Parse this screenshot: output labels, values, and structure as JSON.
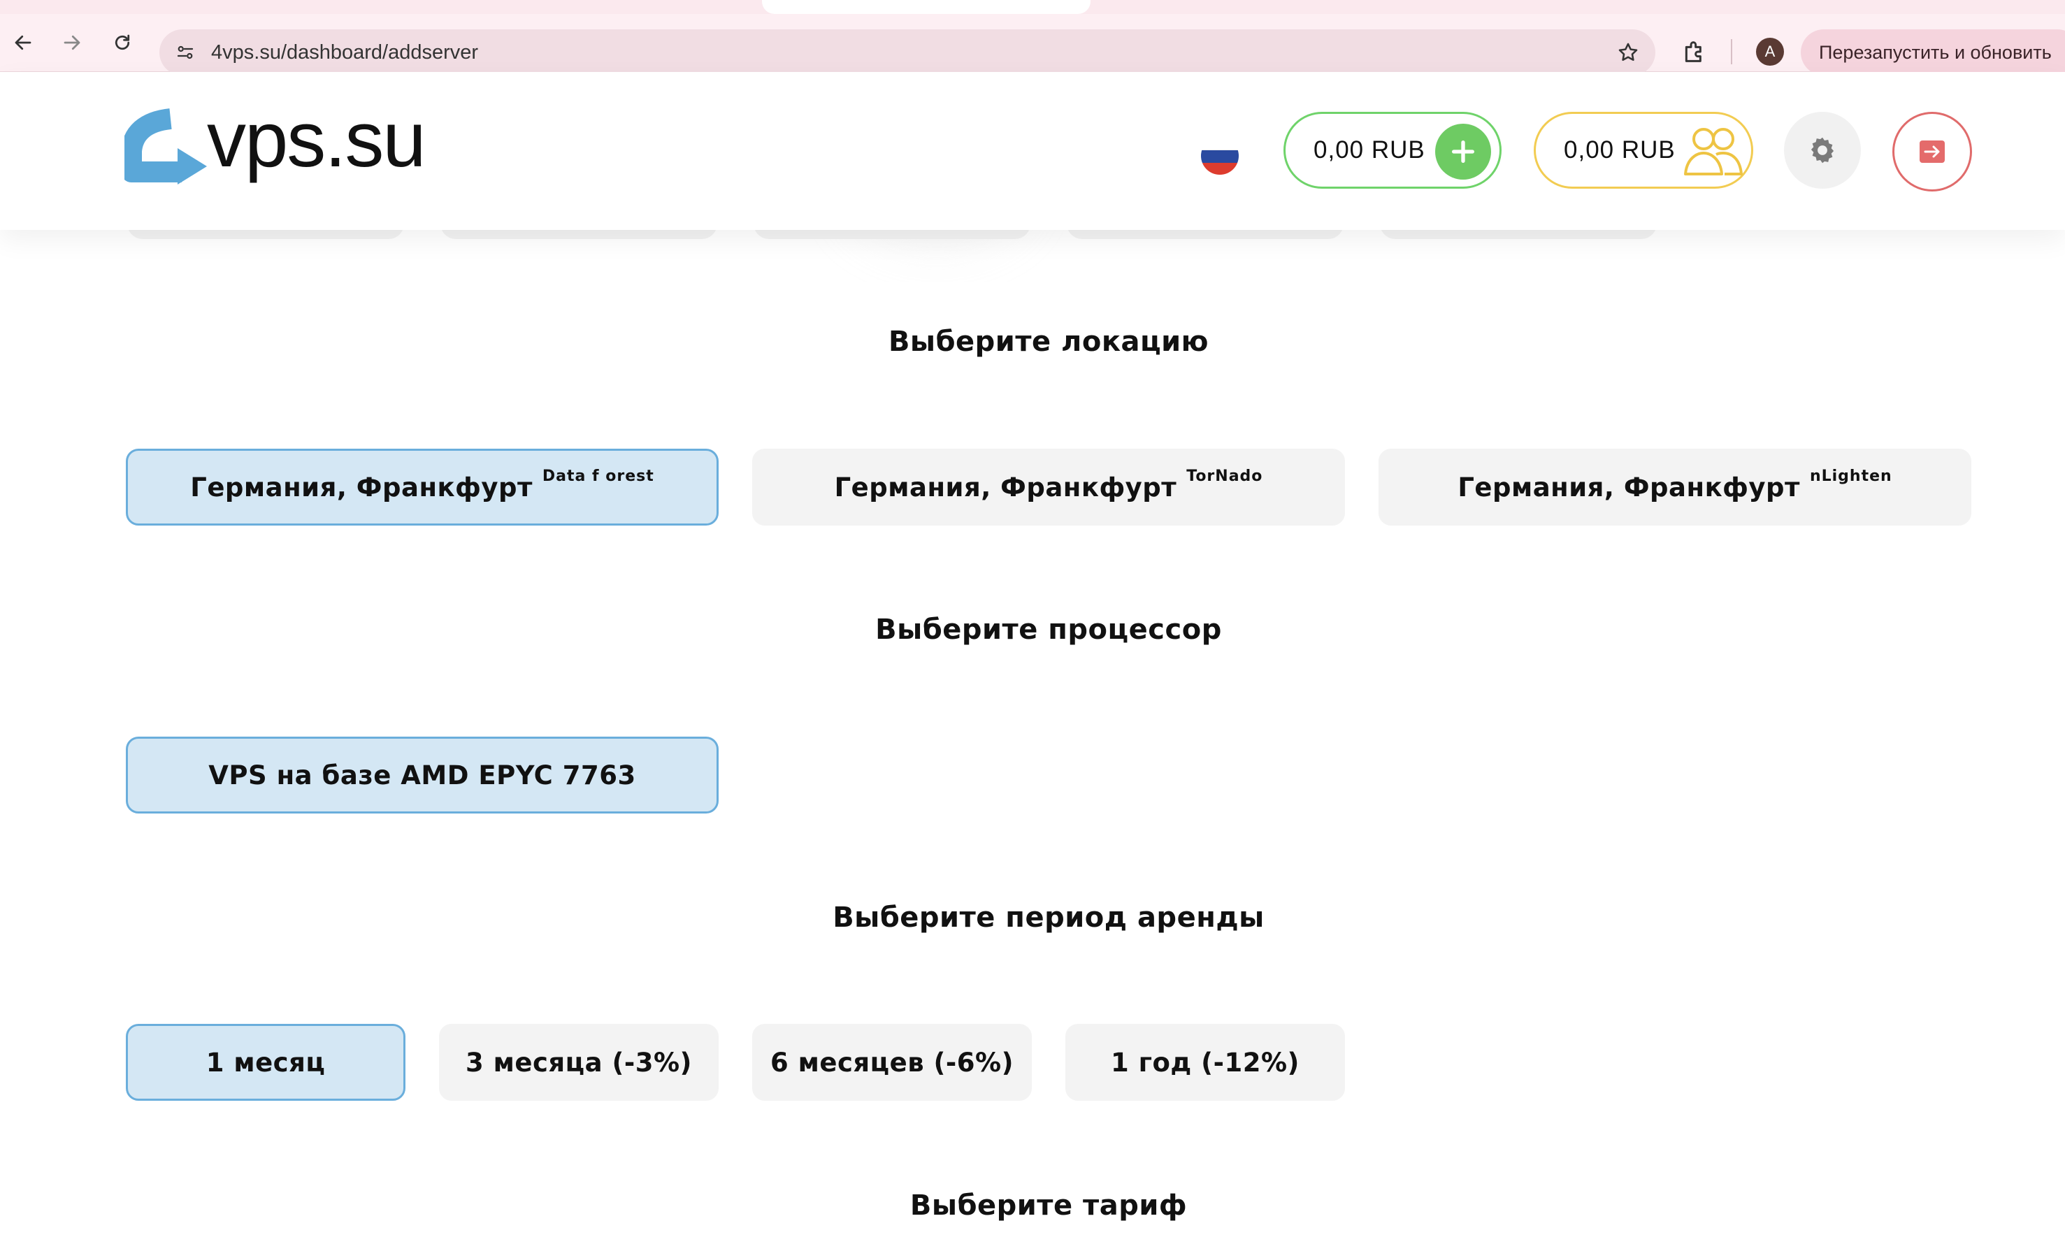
{
  "browser": {
    "url": "4vps.su/dashboard/addserver",
    "profile_initial": "A",
    "relaunch_label": "Перезапустить и обновить"
  },
  "header": {
    "logo_text": "vps.su",
    "balance_main": "0,00 RUB",
    "balance_referral": "0,00 RUB",
    "colors": {
      "green": "#6ecb63",
      "gold": "#f2cc52",
      "logout": "#e06b6b",
      "accent": "#6aaedc"
    }
  },
  "sections": {
    "location": {
      "title": "Выберите локацию",
      "options": [
        {
          "label": "Германия, Франкфурт",
          "sup": "Data f orest",
          "selected": true
        },
        {
          "label": "Германия, Франкфурт",
          "sup": "TorNado",
          "selected": false
        },
        {
          "label": "Германия, Франкфурт",
          "sup": "nLighten",
          "selected": false
        }
      ]
    },
    "processor": {
      "title": "Выберите процессор",
      "options": [
        {
          "label": "VPS на базе AMD EPYC 7763",
          "selected": true
        }
      ]
    },
    "period": {
      "title": "Выберите период аренды",
      "options": [
        {
          "label": "1 месяц",
          "selected": true
        },
        {
          "label": "3 месяца (-3%)",
          "selected": false
        },
        {
          "label": "6 месяцев (-6%)",
          "selected": false
        },
        {
          "label": "1 год (-12%)",
          "selected": false
        }
      ]
    },
    "tariff": {
      "title": "Выберите тариф"
    }
  }
}
